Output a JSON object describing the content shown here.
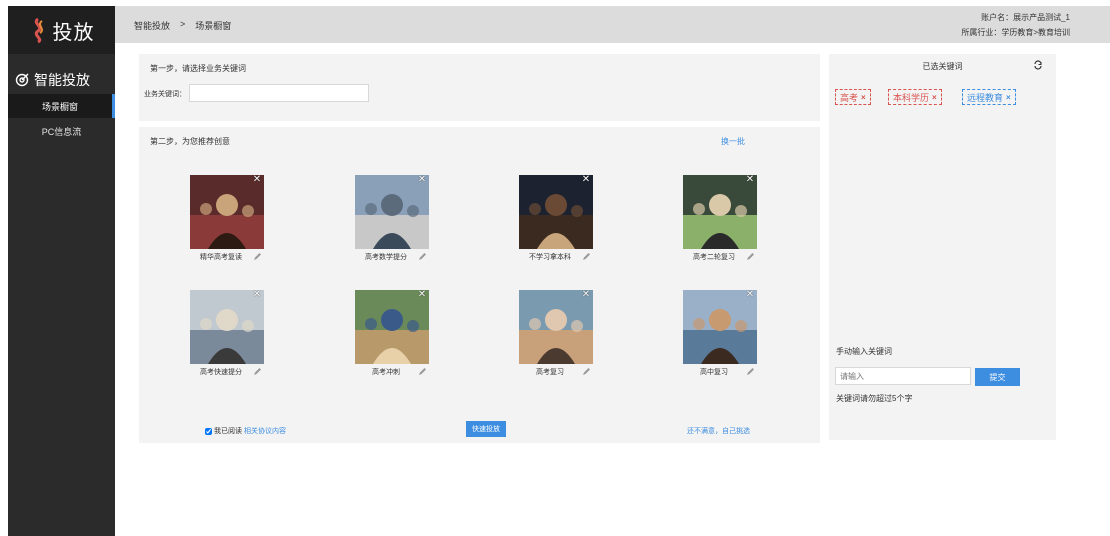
{
  "sidebar": {
    "logo_text": "投放",
    "section_title": "智能投放",
    "items": [
      {
        "label": "场景橱窗",
        "active": true
      },
      {
        "label": "PC信息流",
        "active": false
      }
    ]
  },
  "header": {
    "breadcrumb": [
      "智能投放",
      ">",
      "场景橱窗"
    ],
    "account_name": "账户名：展示产品测试_1",
    "industry": "所属行业：学历教育>教育培训"
  },
  "step1": {
    "title": "第一步，请选择业务关键词",
    "field_label": "业务关键词：",
    "field_value": ""
  },
  "step2": {
    "title": "第二步，为您推荐创意",
    "refresh_label": "换一批",
    "cards": [
      {
        "label": "精华高考复读",
        "icon": "photo-student-reading"
      },
      {
        "label": "高考数学提分",
        "icon": "photo-campus-crowd"
      },
      {
        "label": "不学习拿本科",
        "icon": "photo-graduates"
      },
      {
        "label": "高考二轮复习",
        "icon": "photo-students-tablet"
      },
      {
        "label": "高考快速提分",
        "icon": "photo-student-laptop"
      },
      {
        "label": "高考冲刺",
        "icon": "photo-students-walking"
      },
      {
        "label": "高考复习",
        "icon": "photo-girl-selfie"
      },
      {
        "label": "高中复习",
        "icon": "photo-student-group"
      }
    ],
    "agree_prefix": "我已阅读",
    "agree_link": "相关协议内容",
    "agree_checked": true,
    "quick_launch_label": "快速投放",
    "self_select_label": "还不满意，自己挑选"
  },
  "right": {
    "title": "已选关键词",
    "tags": [
      {
        "label": "高考",
        "color": "#d9534f"
      },
      {
        "label": "本科学历",
        "color": "#d9534f"
      },
      {
        "label": "远程教育",
        "color": "#3d8ee0"
      }
    ],
    "manual_title": "手动输入关键词",
    "manual_placeholder": "请输入",
    "submit_label": "提交",
    "hint": "关键词请勿超过5个字"
  },
  "colors": {
    "accent": "#3d8ee0",
    "tag_red": "#d9534f",
    "sidebar_bg": "#2b2b2b"
  }
}
